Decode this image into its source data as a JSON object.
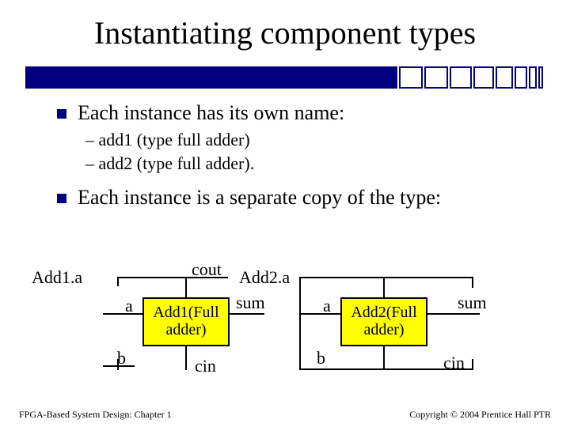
{
  "title": "Instantiating component types",
  "bullets": {
    "b1": "Each instance has its own name:",
    "b1a": "– add1 (type full adder)",
    "b1b": "– add2 (type full adder).",
    "b2": "Each instance is a separate copy of the type:"
  },
  "diagram": {
    "inst1_name": "Add1.a",
    "inst2_name": "Add2.a",
    "port_a": "a",
    "port_b": "b",
    "port_cout": "cout",
    "port_sum": "sum",
    "port_cin": "cin",
    "box1": "Add1(Full adder)",
    "box2": "Add2(Full adder)"
  },
  "footer": {
    "left": "FPGA-Based System Design: Chapter 1",
    "right": "Copyright © 2004 Prentice Hall PTR"
  }
}
